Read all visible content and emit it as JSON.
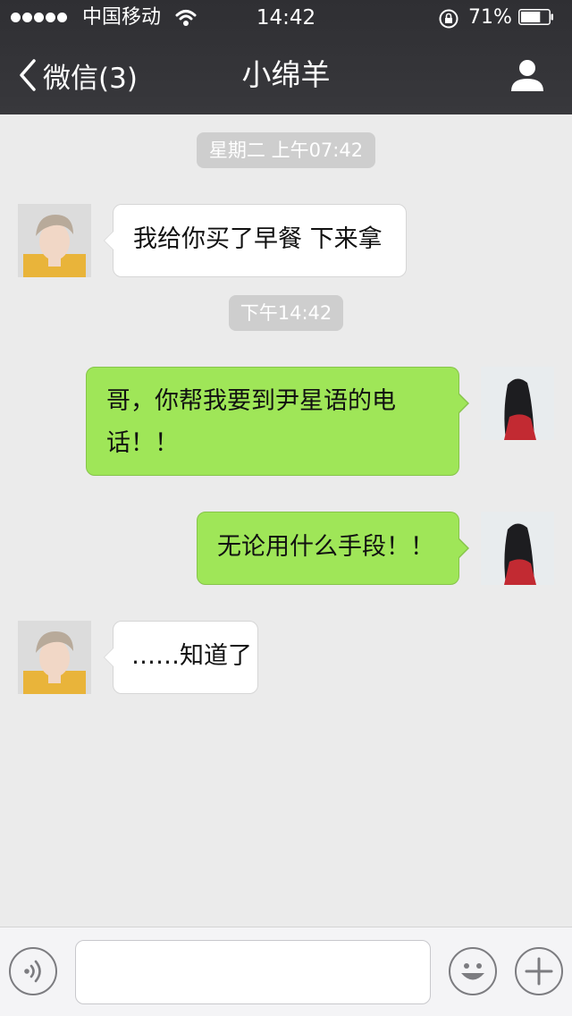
{
  "status_bar": {
    "carrier": "中国移动",
    "time": "14:42",
    "battery_percent": "71%",
    "battery_level": 0.71
  },
  "nav": {
    "back_label": "微信(3)",
    "title": "小绵羊"
  },
  "chat": {
    "timestamps": [
      "星期二 上午07:42",
      "下午14:42"
    ],
    "messages": [
      {
        "direction": "incoming",
        "lines": [
          "我给你买了早餐 下来拿"
        ]
      },
      {
        "direction": "outgoing",
        "lines": [
          "哥，你帮我要到尹星语的电",
          "话！！"
        ]
      },
      {
        "direction": "outgoing",
        "lines": [
          "无论用什么手段！！"
        ]
      },
      {
        "direction": "incoming",
        "lines": [
          "……知道了"
        ]
      }
    ]
  },
  "input_bar": {
    "text_value": "",
    "icons": [
      "voice-icon",
      "emoji-icon",
      "plus-icon"
    ]
  },
  "colors": {
    "nav_background": "#333336",
    "chat_background": "#ebebeb",
    "outgoing_bubble": "#9fe658",
    "incoming_bubble": "#ffffff",
    "timestamp_pill": "#cecece"
  }
}
